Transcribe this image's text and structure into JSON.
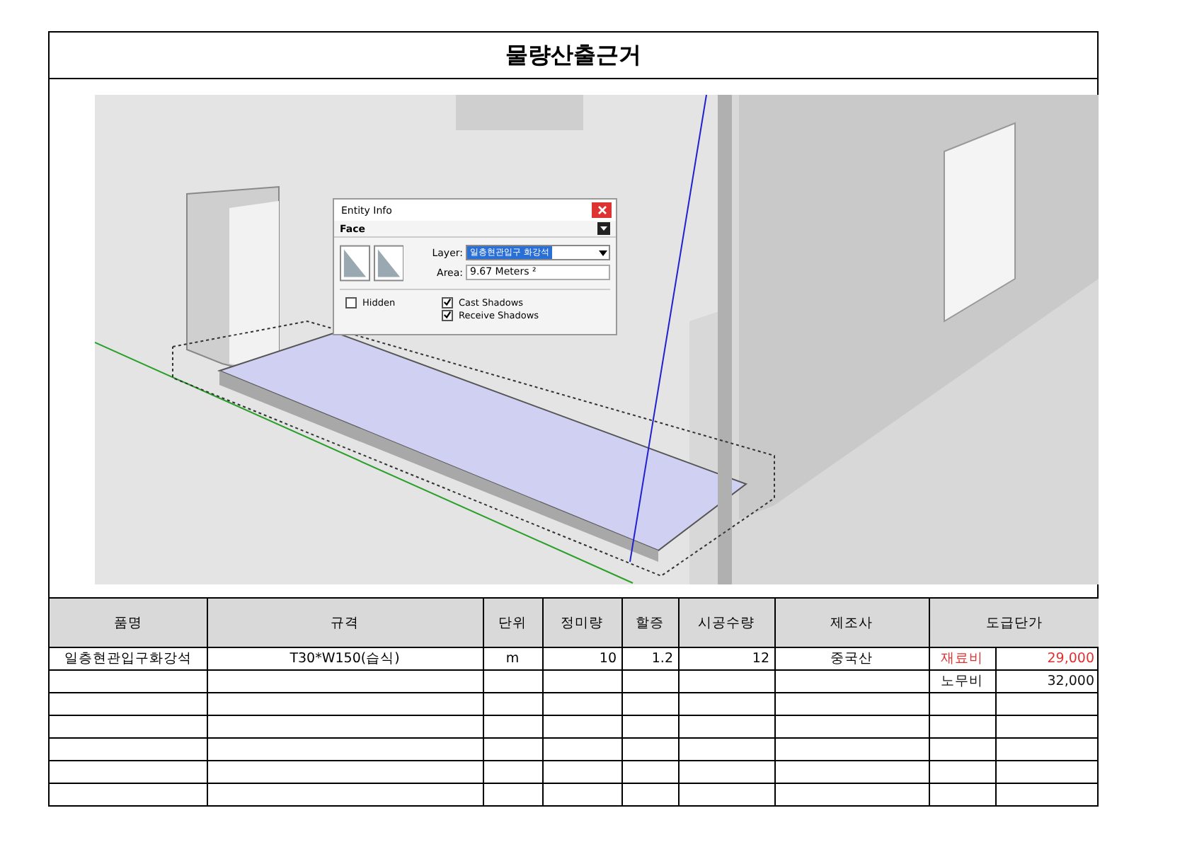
{
  "title": "물량산출근거",
  "entity_info": {
    "title": "Entity Info",
    "type": "Face",
    "layer_label": "Layer:",
    "layer_value": "일층현관입구 화강석",
    "area_label": "Area:",
    "area_value": "9.67 Meters ²",
    "options": [
      {
        "label": "Hidden",
        "checked": false
      },
      {
        "label": "Cast Shadows",
        "checked": true
      },
      {
        "label": "Receive Shadows",
        "checked": true
      }
    ]
  },
  "table": {
    "columns": [
      "품명",
      "규격",
      "단위",
      "정미량",
      "할증",
      "시공수량",
      "제조사",
      "도급단가"
    ],
    "rows": [
      {
        "name": "일층현관입구화강석",
        "spec": "T30*W150(습식)",
        "unit": "m",
        "net": "10",
        "extra": "1.2",
        "qty": "12",
        "maker": "중국산"
      }
    ],
    "costs": [
      {
        "label": "재료비",
        "value": "29,000",
        "color": "#e03030"
      },
      {
        "label": "노무비",
        "value": "32,000",
        "color": "#111111"
      }
    ]
  }
}
